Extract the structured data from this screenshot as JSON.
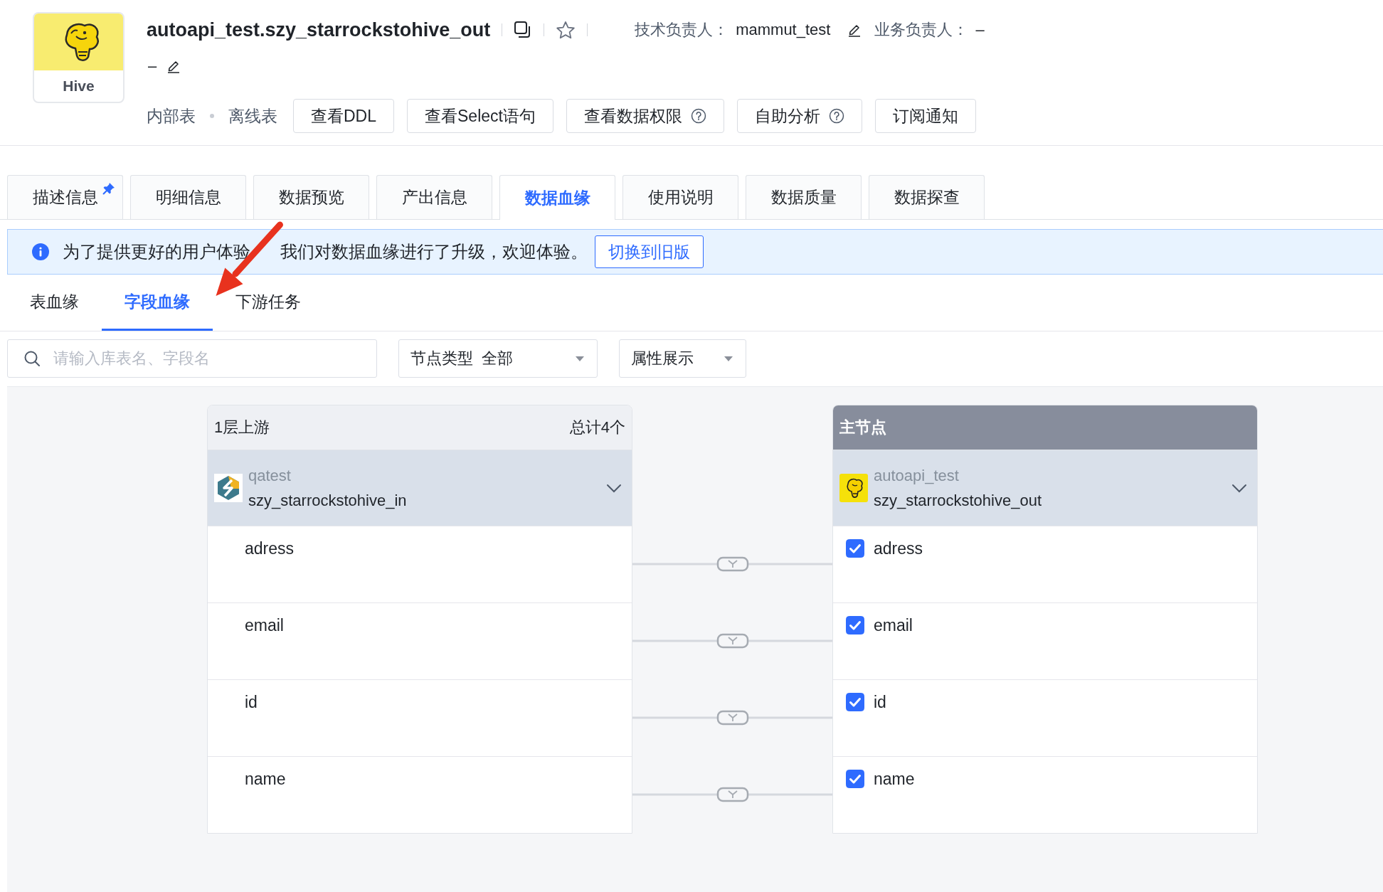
{
  "asset": {
    "logo_label": "Hive",
    "title": "autoapi_test.szy_starrockstohive_out",
    "starred": false,
    "tech_owner_label": "技术负责人：",
    "tech_owner": "mammut_test",
    "biz_owner_label": "业务负责人：",
    "biz_owner": "–",
    "description": "–",
    "tags": [
      "内部表",
      "离线表"
    ],
    "actions": [
      {
        "label": "查看DDL",
        "help": false
      },
      {
        "label": "查看Select语句",
        "help": false
      },
      {
        "label": "查看数据权限",
        "help": true
      },
      {
        "label": "自助分析",
        "help": true
      },
      {
        "label": "订阅通知",
        "help": false
      }
    ]
  },
  "tabs": [
    {
      "label": "描述信息",
      "selected": false,
      "pinned": true
    },
    {
      "label": "明细信息",
      "selected": false,
      "pinned": false
    },
    {
      "label": "数据预览",
      "selected": false,
      "pinned": false
    },
    {
      "label": "产出信息",
      "selected": false,
      "pinned": false
    },
    {
      "label": "数据血缘",
      "selected": true,
      "pinned": false
    },
    {
      "label": "使用说明",
      "selected": false,
      "pinned": false
    },
    {
      "label": "数据质量",
      "selected": false,
      "pinned": false
    },
    {
      "label": "数据探查",
      "selected": false,
      "pinned": false
    }
  ],
  "notice": {
    "text_parts": [
      "为了提供更好的用户体验",
      "我们对数据血缘进行了升级，欢迎体验。"
    ],
    "button": "切换到旧版"
  },
  "lineage_tabs": [
    {
      "label": "表血缘",
      "selected": false
    },
    {
      "label": "字段血缘",
      "selected": true
    },
    {
      "label": "下游任务",
      "selected": false
    }
  ],
  "filters": {
    "search": {
      "placeholder": "请输入库表名、字段名"
    },
    "node_type": {
      "label": "节点类型",
      "value": "全部"
    },
    "attributes": {
      "label": "属性展示"
    }
  },
  "lineage": {
    "nodes": [
      {
        "kind": "upstream",
        "title": "1层上游",
        "count": "总计4个",
        "database": "qatest",
        "table": "szy_starrockstohive_in",
        "fields": [
          {
            "name": "adress",
            "linked": true
          },
          {
            "name": "email",
            "linked": true
          },
          {
            "name": "id",
            "linked": true
          },
          {
            "name": "name",
            "linked": true
          }
        ]
      },
      {
        "kind": "main",
        "title": "主节点",
        "database": "autoapi_test",
        "table": "szy_starrockstohive_out",
        "fields": [
          {
            "name": "adress",
            "checked": true
          },
          {
            "name": "email",
            "checked": true
          },
          {
            "name": "id",
            "checked": true
          },
          {
            "name": "name",
            "checked": true
          }
        ]
      }
    ]
  }
}
